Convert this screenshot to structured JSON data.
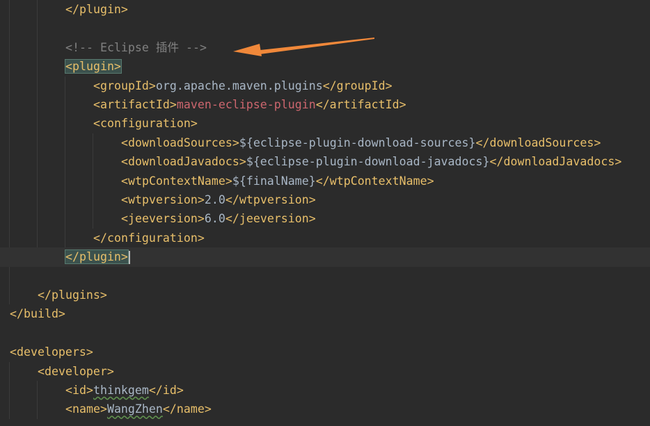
{
  "lines": [
    {
      "tokens": [
        {
          "text": "</plugin>",
          "cls": "tag"
        }
      ]
    },
    {
      "tokens": []
    },
    {
      "tokens": [
        {
          "text": "<!-- Eclipse 插件 -->",
          "cls": "comment"
        }
      ]
    },
    {
      "tokens": [
        {
          "text": "<plugin>",
          "cls": "tag match"
        }
      ]
    },
    {
      "tokens": [
        {
          "text": "<groupId>",
          "cls": "tag"
        },
        {
          "text": "org.apache.maven.plugins",
          "cls": ""
        },
        {
          "text": "</groupId>",
          "cls": "tag"
        }
      ]
    },
    {
      "tokens": [
        {
          "text": "<artifactId>",
          "cls": "tag"
        },
        {
          "text": "maven-eclipse-plugin",
          "cls": "text-red"
        },
        {
          "text": "</artifactId>",
          "cls": "tag"
        }
      ]
    },
    {
      "tokens": [
        {
          "text": "<configuration>",
          "cls": "tag"
        }
      ]
    },
    {
      "tokens": [
        {
          "text": "<downloadSources>",
          "cls": "tag"
        },
        {
          "text": "${eclipse-plugin-download-sources}",
          "cls": ""
        },
        {
          "text": "</downloadSources>",
          "cls": "tag"
        }
      ]
    },
    {
      "tokens": [
        {
          "text": "<downloadJavadocs>",
          "cls": "tag"
        },
        {
          "text": "${eclipse-plugin-download-javadocs}",
          "cls": ""
        },
        {
          "text": "</downloadJavadocs>",
          "cls": "tag"
        }
      ]
    },
    {
      "tokens": [
        {
          "text": "<wtpContextName>",
          "cls": "tag"
        },
        {
          "text": "${finalName}",
          "cls": ""
        },
        {
          "text": "</wtpContextName>",
          "cls": "tag"
        }
      ]
    },
    {
      "tokens": [
        {
          "text": "<wtpversion>",
          "cls": "tag"
        },
        {
          "text": "2.0",
          "cls": ""
        },
        {
          "text": "</wtpversion>",
          "cls": "tag"
        }
      ]
    },
    {
      "tokens": [
        {
          "text": "<jeeversion>",
          "cls": "tag"
        },
        {
          "text": "6.0",
          "cls": ""
        },
        {
          "text": "</jeeversion>",
          "cls": "tag"
        }
      ]
    },
    {
      "tokens": [
        {
          "text": "</configuration>",
          "cls": "tag"
        }
      ]
    },
    {
      "tokens": [
        {
          "text": "</plugin>",
          "cls": "tag match"
        }
      ],
      "current": true,
      "caret": true
    },
    {
      "tokens": []
    },
    {
      "tokens": [
        {
          "text": "</plugins>",
          "cls": "tag"
        }
      ]
    },
    {
      "tokens": [
        {
          "text": "</build>",
          "cls": "tag"
        }
      ]
    },
    {
      "tokens": []
    },
    {
      "tokens": [
        {
          "text": "<developers>",
          "cls": "tag"
        }
      ]
    },
    {
      "tokens": [
        {
          "text": "<developer>",
          "cls": "tag"
        }
      ]
    },
    {
      "tokens": [
        {
          "text": "<id>",
          "cls": "tag"
        },
        {
          "text": "thinkgem",
          "cls": "spell"
        },
        {
          "text": "</id>",
          "cls": "tag"
        }
      ]
    },
    {
      "tokens": [
        {
          "text": "<name>",
          "cls": "tag"
        },
        {
          "text": "WangZhen",
          "cls": "spell"
        },
        {
          "text": "</name>",
          "cls": "tag"
        }
      ]
    }
  ],
  "colors": {
    "background": "#2b2b2b",
    "tag": "#e8bf6a",
    "text": "#a9b7c6",
    "comment": "#808080",
    "value_red": "#cc666e",
    "arrow": "#f0883a"
  },
  "annotation_icon": "arrow-icon"
}
